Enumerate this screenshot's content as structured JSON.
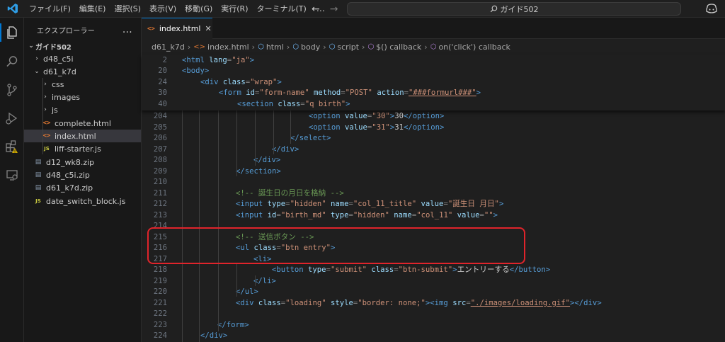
{
  "titlebar": {
    "menu": [
      "ファイル(F)",
      "編集(E)",
      "選択(S)",
      "表示(V)",
      "移動(G)",
      "実行(R)",
      "ターミナル(T)"
    ],
    "more": "…",
    "back": "←",
    "forward": "→",
    "search_text": "ガイド502"
  },
  "activity_icons": [
    "explorer-icon",
    "search-icon",
    "source-control-icon",
    "run-debug-icon",
    "extensions-icon",
    "remote-explorer-icon"
  ],
  "sidebar": {
    "title": "エクスプローラー",
    "more": "…",
    "root": "ガイド502",
    "items": [
      {
        "label": "d48_c5i",
        "type": "folder",
        "open": false,
        "depth": 1
      },
      {
        "label": "d61_k7d",
        "type": "folder",
        "open": true,
        "depth": 1
      },
      {
        "label": "css",
        "type": "folder",
        "open": false,
        "depth": 2
      },
      {
        "label": "images",
        "type": "folder",
        "open": false,
        "depth": 2
      },
      {
        "label": "js",
        "type": "folder",
        "open": false,
        "depth": 2
      },
      {
        "label": "complete.html",
        "type": "html",
        "depth": 2
      },
      {
        "label": "index.html",
        "type": "html",
        "depth": 2,
        "selected": true
      },
      {
        "label": "liff-starter.js",
        "type": "js",
        "depth": 2
      },
      {
        "label": "d12_wk8.zip",
        "type": "zip",
        "depth": 1
      },
      {
        "label": "d48_c5i.zip",
        "type": "zip",
        "depth": 1
      },
      {
        "label": "d61_k7d.zip",
        "type": "zip",
        "depth": 1
      },
      {
        "label": "date_switch_block.js",
        "type": "js",
        "depth": 1
      }
    ]
  },
  "tab": {
    "label": "index.html",
    "close": "✕"
  },
  "breadcrumb": [
    "d61_k7d",
    "index.html",
    "html",
    "body",
    "script",
    "$() callback",
    "on('click') callback"
  ],
  "sticky_lines": [
    {
      "n": "2",
      "tokens": [
        [
          "t",
          "<html "
        ],
        [
          "a",
          "lang"
        ],
        [
          "p",
          "="
        ],
        [
          "s",
          "\"ja\""
        ],
        [
          "t",
          ">"
        ]
      ]
    },
    {
      "n": "20",
      "tokens": [
        [
          "t",
          "<body>"
        ]
      ]
    },
    {
      "n": "24",
      "tokens": [
        [
          "t",
          "<div "
        ],
        [
          "a",
          "class"
        ],
        [
          "p",
          "="
        ],
        [
          "s",
          "\"wrap\""
        ],
        [
          "t",
          ">"
        ]
      ]
    },
    {
      "n": "30",
      "tokens": [
        [
          "t",
          "<form "
        ],
        [
          "a",
          "id"
        ],
        [
          "p",
          "="
        ],
        [
          "s",
          "\"form-name\" "
        ],
        [
          "a",
          "method"
        ],
        [
          "p",
          "="
        ],
        [
          "s",
          "\"POST\" "
        ],
        [
          "a",
          "action"
        ],
        [
          "p",
          "="
        ],
        [
          "su",
          "\"###formurl###\""
        ],
        [
          "t",
          ">"
        ]
      ]
    },
    {
      "n": "40",
      "tokens": [
        [
          "t",
          "<section "
        ],
        [
          "a",
          "class"
        ],
        [
          "p",
          "="
        ],
        [
          "s",
          "\"q birth\""
        ],
        [
          "t",
          ">"
        ]
      ]
    }
  ],
  "code_lines": [
    {
      "n": "204",
      "tokens": [
        [
          "t",
          "<option "
        ],
        [
          "a",
          "value"
        ],
        [
          "p",
          "="
        ],
        [
          "s",
          "\"30\""
        ],
        [
          "t",
          ">"
        ],
        [
          "x",
          "30"
        ],
        [
          "t",
          "</option>"
        ]
      ]
    },
    {
      "n": "205",
      "tokens": [
        [
          "t",
          "<option "
        ],
        [
          "a",
          "value"
        ],
        [
          "p",
          "="
        ],
        [
          "s",
          "\"31\""
        ],
        [
          "t",
          ">"
        ],
        [
          "x",
          "31"
        ],
        [
          "t",
          "</option>"
        ]
      ]
    },
    {
      "n": "206",
      "tokens": [
        [
          "t",
          "</select>"
        ]
      ]
    },
    {
      "n": "207",
      "tokens": [
        [
          "t",
          "</div>"
        ]
      ]
    },
    {
      "n": "208",
      "tokens": [
        [
          "t",
          "</div>"
        ]
      ]
    },
    {
      "n": "209",
      "tokens": [
        [
          "t",
          "</section>"
        ]
      ]
    },
    {
      "n": "210",
      "tokens": []
    },
    {
      "n": "211",
      "tokens": [
        [
          "c",
          "<!-- 誕生日の月日を格納 -->"
        ]
      ]
    },
    {
      "n": "212",
      "tokens": [
        [
          "t",
          "<input "
        ],
        [
          "a",
          "type"
        ],
        [
          "p",
          "="
        ],
        [
          "s",
          "\"hidden\" "
        ],
        [
          "a",
          "name"
        ],
        [
          "p",
          "="
        ],
        [
          "s",
          "\"col_11_title\" "
        ],
        [
          "a",
          "value"
        ],
        [
          "p",
          "="
        ],
        [
          "s",
          "\"誕生日 月日\""
        ],
        [
          "t",
          ">"
        ]
      ]
    },
    {
      "n": "213",
      "tokens": [
        [
          "t",
          "<input "
        ],
        [
          "a",
          "id"
        ],
        [
          "p",
          "="
        ],
        [
          "s",
          "\"birth_md\" "
        ],
        [
          "a",
          "type"
        ],
        [
          "p",
          "="
        ],
        [
          "s",
          "\"hidden\" "
        ],
        [
          "a",
          "name"
        ],
        [
          "p",
          "="
        ],
        [
          "s",
          "\"col_11\" "
        ],
        [
          "a",
          "value"
        ],
        [
          "p",
          "="
        ],
        [
          "s",
          "\"\""
        ],
        [
          "t",
          ">"
        ]
      ]
    },
    {
      "n": "214",
      "tokens": []
    },
    {
      "n": "215",
      "tokens": [
        [
          "c",
          "<!-- 送信ボタン -->"
        ]
      ]
    },
    {
      "n": "216",
      "tokens": [
        [
          "t",
          "<ul "
        ],
        [
          "a",
          "class"
        ],
        [
          "p",
          "="
        ],
        [
          "s",
          "\"btn entry\""
        ],
        [
          "t",
          ">"
        ]
      ]
    },
    {
      "n": "217",
      "tokens": [
        [
          "t",
          "<li>"
        ]
      ]
    },
    {
      "n": "218",
      "tokens": [
        [
          "t",
          "<button "
        ],
        [
          "a",
          "type"
        ],
        [
          "p",
          "="
        ],
        [
          "s",
          "\"submit\" "
        ],
        [
          "a",
          "class"
        ],
        [
          "p",
          "="
        ],
        [
          "s",
          "\"btn-submit\""
        ],
        [
          "t",
          ">"
        ],
        [
          "x",
          "エントリーする"
        ],
        [
          "t",
          "</button>"
        ]
      ]
    },
    {
      "n": "219",
      "tokens": [
        [
          "t",
          "</li>"
        ]
      ]
    },
    {
      "n": "220",
      "tokens": [
        [
          "t",
          "</ul>"
        ]
      ]
    },
    {
      "n": "221",
      "tokens": [
        [
          "t",
          "<div "
        ],
        [
          "a",
          "class"
        ],
        [
          "p",
          "="
        ],
        [
          "s",
          "\"loading\" "
        ],
        [
          "a",
          "style"
        ],
        [
          "p",
          "="
        ],
        [
          "s",
          "\"border: none;\""
        ],
        [
          "t",
          "><img "
        ],
        [
          "a",
          "src"
        ],
        [
          "p",
          "="
        ],
        [
          "su",
          "\"./images/loading.gif\""
        ],
        [
          "t",
          "></div>"
        ]
      ]
    },
    {
      "n": "222",
      "tokens": []
    },
    {
      "n": "223",
      "tokens": [
        [
          "t",
          "</form>"
        ]
      ]
    },
    {
      "n": "224",
      "tokens": [
        [
          "t",
          "</div>"
        ]
      ]
    }
  ],
  "colors": {
    "accent": "#0078d4",
    "highlight_box": "#e0242b",
    "tag": "#569cd6",
    "attr": "#9cdcfe",
    "string": "#ce9178",
    "comment": "#6a9955"
  }
}
